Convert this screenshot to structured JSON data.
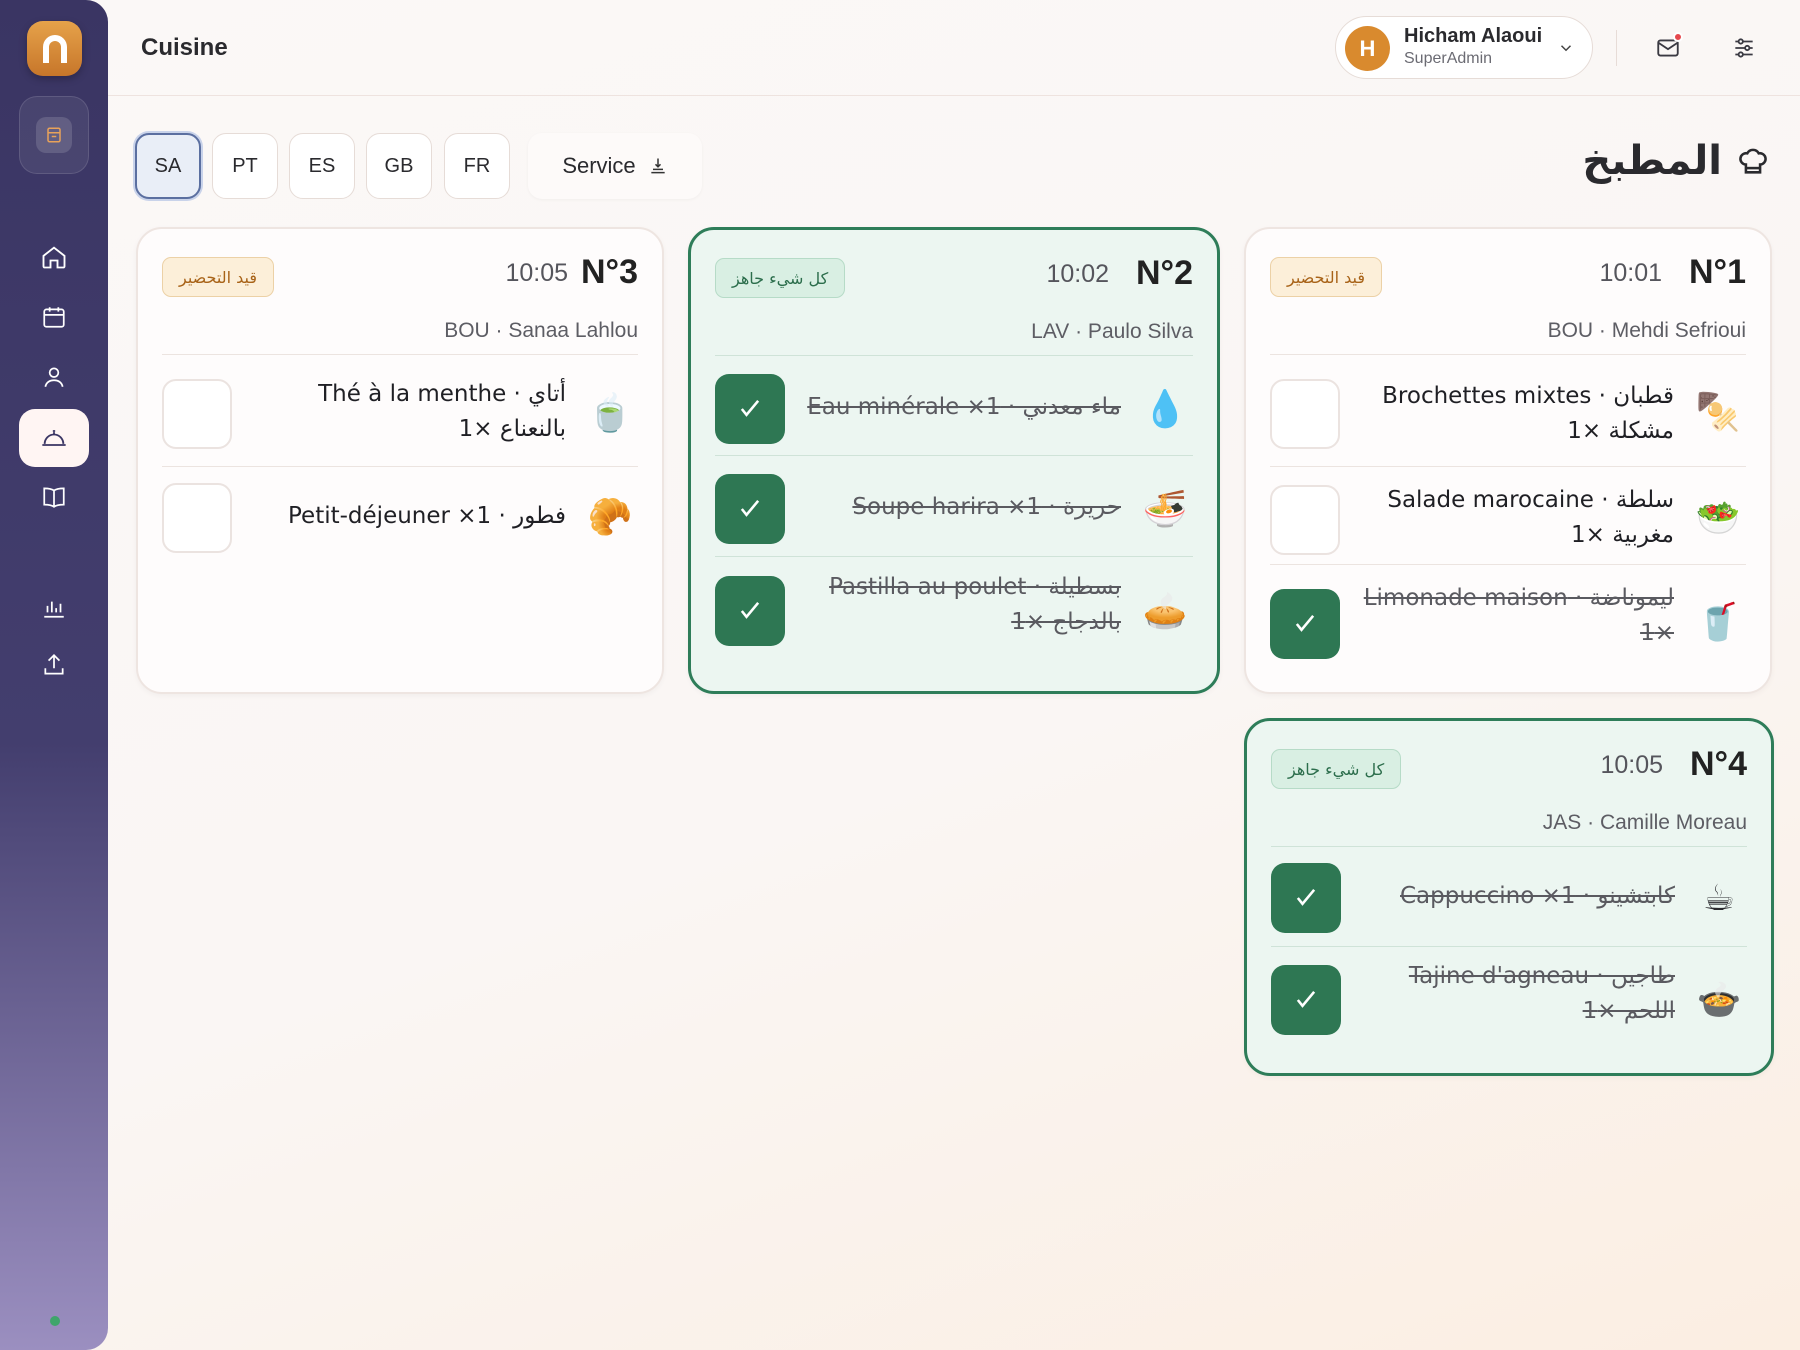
{
  "header": {
    "title": "Cuisine",
    "user": {
      "initial": "H",
      "name": "Hicham Alaoui",
      "role": "SuperAdmin"
    }
  },
  "sidebar": {
    "items": [
      "store",
      "home",
      "calendar",
      "user",
      "kitchen",
      "menu",
      "stats",
      "export"
    ],
    "active": "kitchen"
  },
  "filters": {
    "languages": [
      "SA",
      "PT",
      "ES",
      "GB",
      "FR"
    ],
    "active_language": "SA",
    "service_label": "Service"
  },
  "page": {
    "title": "المطبخ"
  },
  "colors": {
    "accent_green": "#2e7753",
    "prep_badge": "#a86318",
    "sidebar": "#3a3563"
  },
  "orders": [
    {
      "number": "N°1",
      "time": "10:01",
      "meta": "BOU · Mehdi Sefrioui",
      "status": "قيد التحضير",
      "ready": false,
      "items": [
        {
          "line1": "قطبان · Brochettes mixtes",
          "line2": "مشكلة ×1",
          "done": false,
          "emoji": "🍢"
        },
        {
          "line1": "سلطة · Salade marocaine",
          "line2": "مغربية ×1",
          "done": false,
          "emoji": "🥗"
        },
        {
          "line1": "ليموناضة · Limonade maison",
          "line2": "×1",
          "done": true,
          "emoji": "🥤"
        }
      ]
    },
    {
      "number": "N°2",
      "time": "10:02",
      "meta": "LAV · Paulo Silva",
      "status": "كل شيء جاهز",
      "ready": true,
      "items": [
        {
          "line1": "ماء معدني · Eau minérale ×1",
          "line2": "",
          "done": true,
          "emoji": "💧"
        },
        {
          "line1": "حريرة · Soupe harira ×1",
          "line2": "",
          "done": true,
          "emoji": "🍜"
        },
        {
          "line1": "بسطيلة · Pastilla au poulet",
          "line2": "بالدجاج ×1",
          "done": true,
          "emoji": "🥧"
        }
      ]
    },
    {
      "number": "N°3",
      "time": "10:05",
      "meta": "BOU · Sanaa Lahlou",
      "status": "قيد التحضير",
      "ready": false,
      "items": [
        {
          "line1": "أتاي · Thé à la menthe",
          "line2": "بالنعناع ×1",
          "done": false,
          "emoji": "🍵"
        },
        {
          "line1": "فطور · Petit-déjeuner ×1",
          "line2": "",
          "done": false,
          "emoji": "🥐"
        }
      ]
    },
    {
      "number": "N°4",
      "time": "10:05",
      "meta": "JAS · Camille Moreau",
      "status": "كل شيء جاهز",
      "ready": true,
      "items": [
        {
          "line1": "كابتشينو · Cappuccino ×1",
          "line2": "",
          "done": true,
          "emoji": "☕"
        },
        {
          "line1": "طاجين · Tajine d'agneau",
          "line2": "اللحم ×1",
          "done": true,
          "emoji": "🍲"
        }
      ]
    }
  ]
}
